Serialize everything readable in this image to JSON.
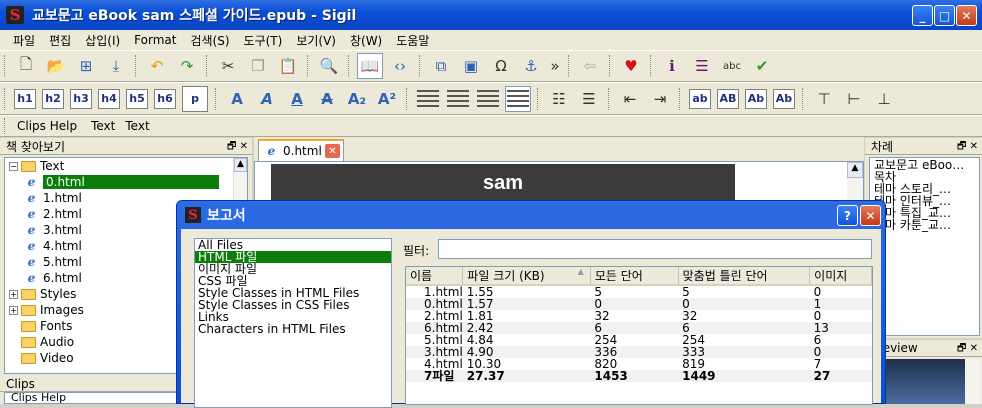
{
  "window": {
    "title": "교보문고 eBook sam 스페셜 가이드.epub - Sigil"
  },
  "menu": [
    "파일",
    "편집",
    "삽입(I)",
    "Format",
    "검색(S)",
    "도구(T)",
    "보기(V)",
    "창(W)",
    "도움말"
  ],
  "toolbar3": {
    "clips_help": "Clips Help",
    "text1": "Text",
    "text2": "Text"
  },
  "format_buttons": {
    "h1": "h1",
    "h2": "h2",
    "h3": "h3",
    "h4": "h4",
    "h5": "h5",
    "h6": "h6",
    "p": "p",
    "ab": "ab",
    "AB": "AB",
    "Ab": "Ab",
    "Ab2": "Ab"
  },
  "browser": {
    "title": "책 찾아보기",
    "items": [
      {
        "label": "Text",
        "type": "folder",
        "expanded": true
      },
      {
        "label": "0.html",
        "type": "file",
        "selected": true
      },
      {
        "label": "1.html",
        "type": "file"
      },
      {
        "label": "2.html",
        "type": "file"
      },
      {
        "label": "3.html",
        "type": "file"
      },
      {
        "label": "4.html",
        "type": "file"
      },
      {
        "label": "5.html",
        "type": "file"
      },
      {
        "label": "6.html",
        "type": "file"
      },
      {
        "label": "Styles",
        "type": "folder",
        "expandable": true
      },
      {
        "label": "Images",
        "type": "folder",
        "expandable": true
      },
      {
        "label": "Fonts",
        "type": "folder"
      },
      {
        "label": "Audio",
        "type": "folder"
      },
      {
        "label": "Video",
        "type": "folder"
      }
    ]
  },
  "clips": {
    "title": "Clips",
    "item": "Clips Help"
  },
  "editor": {
    "tab_label": "0.html",
    "banner_text": "sam"
  },
  "toc": {
    "title": "차례",
    "items": [
      "교보문고 eBoo…",
      "목차",
      "테마 스토리_…",
      "테마 인터뷰_…",
      "테마 특집_교…",
      "테마 카툰_교…"
    ]
  },
  "preview": {
    "title": "Preview"
  },
  "report": {
    "title": "보고서",
    "categories": [
      "All Files",
      "HTML 파일",
      "이미지 파일",
      "CSS 파일",
      "Style Classes in HTML Files",
      "Style Classes in CSS Files",
      "Links",
      "Characters in HTML Files"
    ],
    "selected_category": "HTML 파일",
    "filter_label": "필터:",
    "filter_value": "",
    "columns": [
      "이름",
      "파일 크기 (KB)",
      "모든 단어",
      "맞춤법 틀린 단어",
      "이미지"
    ],
    "rows": [
      [
        "1.html",
        "1.55",
        "5",
        "5",
        "0"
      ],
      [
        "0.html",
        "1.57",
        "0",
        "0",
        "1"
      ],
      [
        "2.html",
        "1.81",
        "32",
        "32",
        "0"
      ],
      [
        "6.html",
        "2.42",
        "6",
        "6",
        "13"
      ],
      [
        "5.html",
        "4.84",
        "254",
        "254",
        "6"
      ],
      [
        "3.html",
        "4.90",
        "336",
        "333",
        "0"
      ],
      [
        "4.html",
        "10.30",
        "820",
        "819",
        "7"
      ]
    ],
    "total": [
      "7파일",
      "27.37",
      "1453",
      "1449",
      "27"
    ]
  },
  "colors": {
    "title_blue": "#0a4fd6",
    "selection_green": "#0a7d0a"
  }
}
